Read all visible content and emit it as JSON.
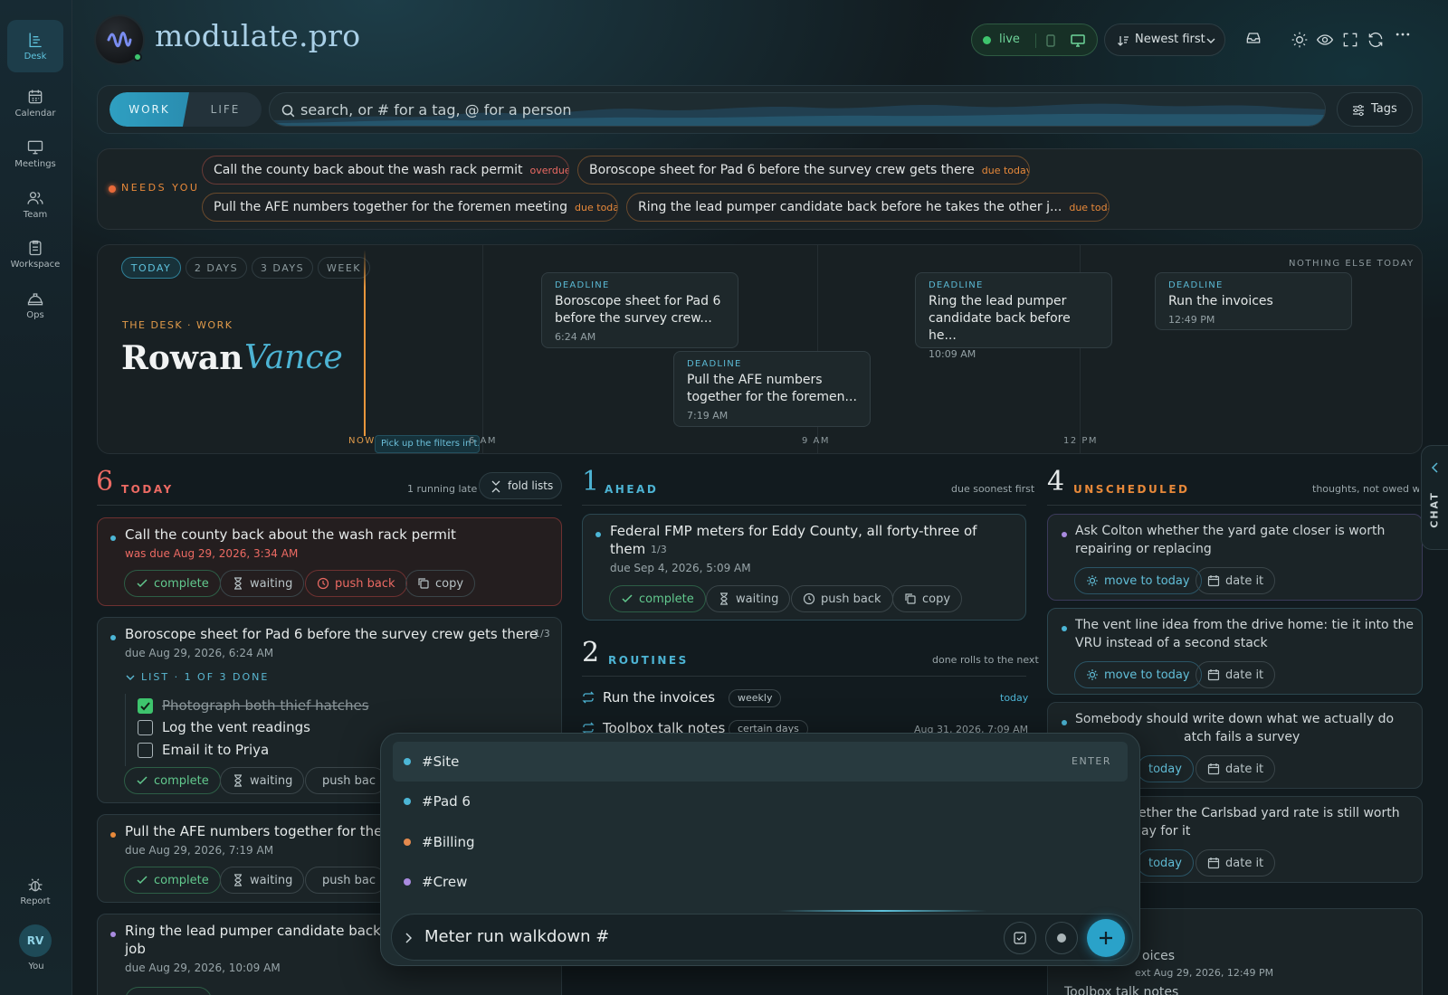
{
  "sidebar": {
    "items": [
      {
        "label": "Desk",
        "icon": "desk-icon"
      },
      {
        "label": "Calendar",
        "icon": "calendar-icon"
      },
      {
        "label": "Meetings",
        "icon": "meetings-icon"
      },
      {
        "label": "Team",
        "icon": "team-icon"
      },
      {
        "label": "Workspace",
        "icon": "workspace-icon"
      },
      {
        "label": "Ops",
        "icon": "ops-icon"
      }
    ],
    "report_label": "Report",
    "avatar_initials": "RV",
    "you_label": "You"
  },
  "header": {
    "brand": "modulate.pro",
    "live_label": "live",
    "sort_label": "Newest first"
  },
  "filterbar": {
    "mode_work": "WORK",
    "mode_life": "LIFE",
    "search_placeholder": "search, or # for a tag, @ for a person",
    "tags_label": "Tags"
  },
  "needs_you": {
    "label": "NEEDS YOU",
    "items": [
      {
        "text": "Call the county back about the wash rack permit",
        "tag": "overdue"
      },
      {
        "text": "Boroscope sheet for Pad 6 before the survey crew gets there",
        "tag": "due today"
      },
      {
        "text": "Pull the AFE numbers together for the foremen meeting",
        "tag": "due today"
      },
      {
        "text": "Ring the lead pumper candidate back before he takes the other j...",
        "tag": "due today"
      }
    ]
  },
  "timeline": {
    "ranges": [
      "TODAY",
      "2 DAYS",
      "3 DAYS",
      "WEEK"
    ],
    "eyebrow": "THE DESK · WORK",
    "first_name": "Rowan",
    "last_name": "Vance",
    "nothing_else": "NOTHING ELSE TODAY",
    "now_label": "NOW",
    "hint": "Pick up the filters in t...",
    "axis": [
      "6 AM",
      "9 AM",
      "12 PM"
    ],
    "deadlines": [
      {
        "kind": "DEADLINE",
        "title": "Boroscope sheet for Pad 6 before the survey crew...",
        "time": "6:24 AM"
      },
      {
        "kind": "DEADLINE",
        "title": "Pull the AFE numbers together for the foremen...",
        "time": "7:19 AM"
      },
      {
        "kind": "DEADLINE",
        "title": "Ring the lead pumper candidate back before he...",
        "time": "10:09 AM"
      },
      {
        "kind": "DEADLINE",
        "title": "Run the invoices",
        "time": "12:49 PM"
      }
    ]
  },
  "today": {
    "count": "6",
    "label": "TODAY",
    "note": "1 running late",
    "fold_label": "fold lists",
    "cards": [
      {
        "title": "Call the county back about the wash rack permit",
        "due": "was due Aug 29, 2026, 3:34 AM"
      },
      {
        "title": "Boroscope sheet for Pad 6 before the survey crew gets there",
        "progress": "1/3",
        "due": "due Aug 29, 2026, 6:24 AM",
        "list_label": "LIST · 1 OF 3 DONE",
        "checklist": [
          {
            "text": "Photograph both thief hatches",
            "done": true
          },
          {
            "text": "Log the vent readings",
            "done": false
          },
          {
            "text": "Email it to Priya",
            "done": false
          }
        ]
      },
      {
        "title": "Pull the AFE numbers together for the fo",
        "due": "due Aug 29, 2026, 7:19 AM"
      },
      {
        "title": "Ring the lead pumper candidate back b",
        "title2": "job",
        "due": "due Aug 29, 2026, 10:09 AM"
      }
    ],
    "actions": {
      "complete": "complete",
      "waiting": "waiting",
      "push_back": "push back",
      "push_back_cut": "push bac",
      "copy": "copy"
    }
  },
  "ahead": {
    "count": "1",
    "label": "AHEAD",
    "note": "due soonest first",
    "card": {
      "title": "Federal FMP meters for Eddy County, all forty-three of",
      "title2": "them",
      "progress": "1/3",
      "due": "due Sep 4, 2026, 5:09 AM"
    }
  },
  "routines": {
    "count": "2",
    "label": "ROUTINES",
    "note": "done rolls to the next",
    "items": [
      {
        "title": "Run the invoices",
        "badge": "weekly",
        "when": "today"
      },
      {
        "title": "Toolbox talk notes",
        "badge": "certain days",
        "when": "Aug 31, 2026, 7:09 AM"
      }
    ]
  },
  "unscheduled": {
    "count": "4",
    "label": "UNSCHEDULED",
    "note": "thoughts, not owed wor",
    "move_label": "move to today",
    "move_cut": "today",
    "date_label": "date it",
    "cards": [
      {
        "line1": "Ask Colton whether the yard gate closer is worth",
        "line2": "repairing or replacing"
      },
      {
        "line1": "The vent line idea from the drive home: tie it into the",
        "line2": "VRU instead of a second stack"
      },
      {
        "line1": "Somebody should write down what we actually do",
        "line2": "atch fails a survey"
      },
      {
        "line1": "ether the Carlsbad yard rate is still worth",
        "line2": "ay for it"
      }
    ],
    "peek": {
      "line1": "oices",
      "line2": "ext Aug 29, 2026, 12:49 PM",
      "line3": "Toolbox talk notes"
    }
  },
  "popup": {
    "enter_hint": "ENTER",
    "suggestions": [
      {
        "tag": "#Site",
        "color": "#4cb6d6"
      },
      {
        "tag": "#Pad 6",
        "color": "#4cb6d6"
      },
      {
        "tag": "#Billing",
        "color": "#e58a4e"
      },
      {
        "tag": "#Crew",
        "color": "#a98be0"
      }
    ],
    "composer_value": "Meter run walkdown #"
  },
  "chat_label": "CHAT",
  "colors": {
    "accent": "#4cb6d6",
    "overdue": "#ec6a63",
    "due": "#e8893a",
    "live": "#3ec46d"
  }
}
